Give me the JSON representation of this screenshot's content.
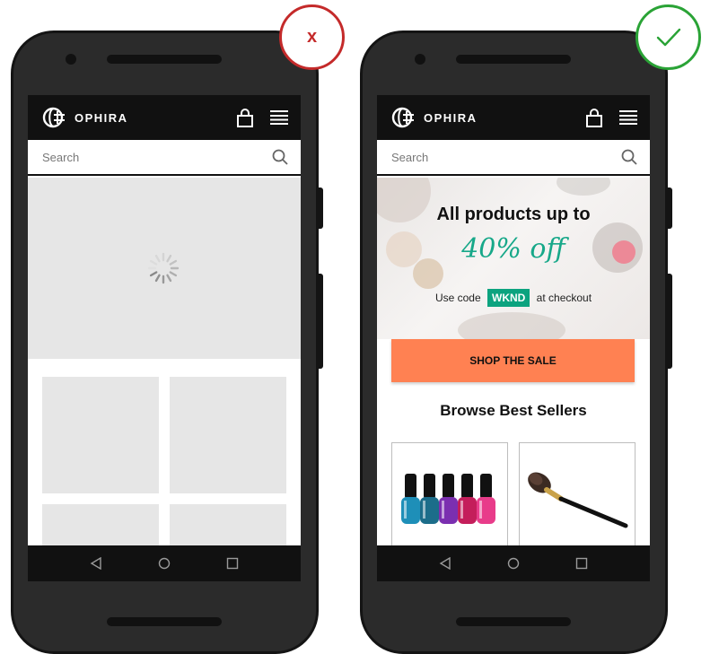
{
  "colors": {
    "phone_body": "#2b2b2b",
    "header_bg": "#111111",
    "skeleton": "#e6e6e6",
    "discount_text": "#17a889",
    "code_badge": "#0ca37f",
    "cta": "#ff8152",
    "bad_badge": "#c42a2a",
    "good_badge": "#2aa336"
  },
  "bad_example": {
    "badge_mark": "x",
    "app": {
      "brand": "OPHIRA",
      "search_placeholder": "Search",
      "icons": [
        "ophira-logo-icon",
        "shopping-bag-icon",
        "hamburger-menu-icon",
        "search-icon"
      ]
    },
    "content_state": "loading",
    "loading_icon": "spinner-icon"
  },
  "good_example": {
    "badge_mark": "checkmark-icon",
    "app": {
      "brand": "OPHIRA",
      "search_placeholder": "Search",
      "icons": [
        "ophira-logo-icon",
        "shopping-bag-icon",
        "hamburger-menu-icon",
        "search-icon"
      ]
    },
    "hero": {
      "title": "All products up to",
      "discount": "40% off",
      "code_prefix": "Use code",
      "code": "WKND",
      "code_suffix": "at checkout"
    },
    "cta_label": "SHOP THE SALE",
    "section_title": "Browse Best Sellers",
    "products": [
      {
        "image": "nail-polish-bottles-image"
      },
      {
        "image": "makeup-brush-image"
      }
    ]
  },
  "android_nav": [
    "back-icon",
    "home-icon",
    "recents-icon"
  ]
}
